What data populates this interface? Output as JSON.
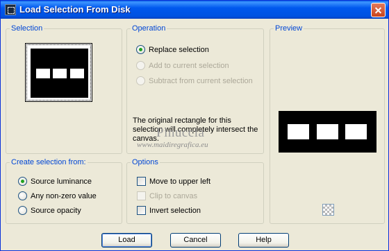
{
  "window": {
    "title": "Load Selection From Disk",
    "icon": "selection-dialog-icon"
  },
  "selection_group": {
    "title": "Selection"
  },
  "operation_group": {
    "title": "Operation",
    "options": [
      {
        "label": "Replace selection",
        "checked": true,
        "enabled": true
      },
      {
        "label": "Add to current selection",
        "checked": false,
        "enabled": false
      },
      {
        "label": "Subtract from current selection",
        "checked": false,
        "enabled": false
      }
    ],
    "info_text": "The original rectangle for this selection will completely intersect the canvas."
  },
  "watermark": {
    "name": "Pinuccia",
    "url": "www.maidiregrafica.eu"
  },
  "preview_group": {
    "title": "Preview",
    "transparency_icon": "checkerboard-icon"
  },
  "create_from_group": {
    "title": "Create selection from:",
    "options": [
      {
        "label": "Source luminance",
        "checked": true
      },
      {
        "label": "Any non-zero value",
        "checked": false
      },
      {
        "label": "Source opacity",
        "checked": false
      }
    ]
  },
  "options_group": {
    "title": "Options",
    "options": [
      {
        "label": "Move to upper left",
        "checked": false,
        "enabled": true
      },
      {
        "label": "Clip to canvas",
        "checked": false,
        "enabled": false
      },
      {
        "label": "Invert selection",
        "checked": false,
        "enabled": true
      }
    ]
  },
  "buttons": {
    "load": "Load",
    "cancel": "Cancel",
    "help": "Help"
  },
  "colors": {
    "titlebar": "#0054e3",
    "group_title": "#0046d5",
    "dialog_bg": "#ece9d8",
    "radio_checked": "#21a121"
  }
}
